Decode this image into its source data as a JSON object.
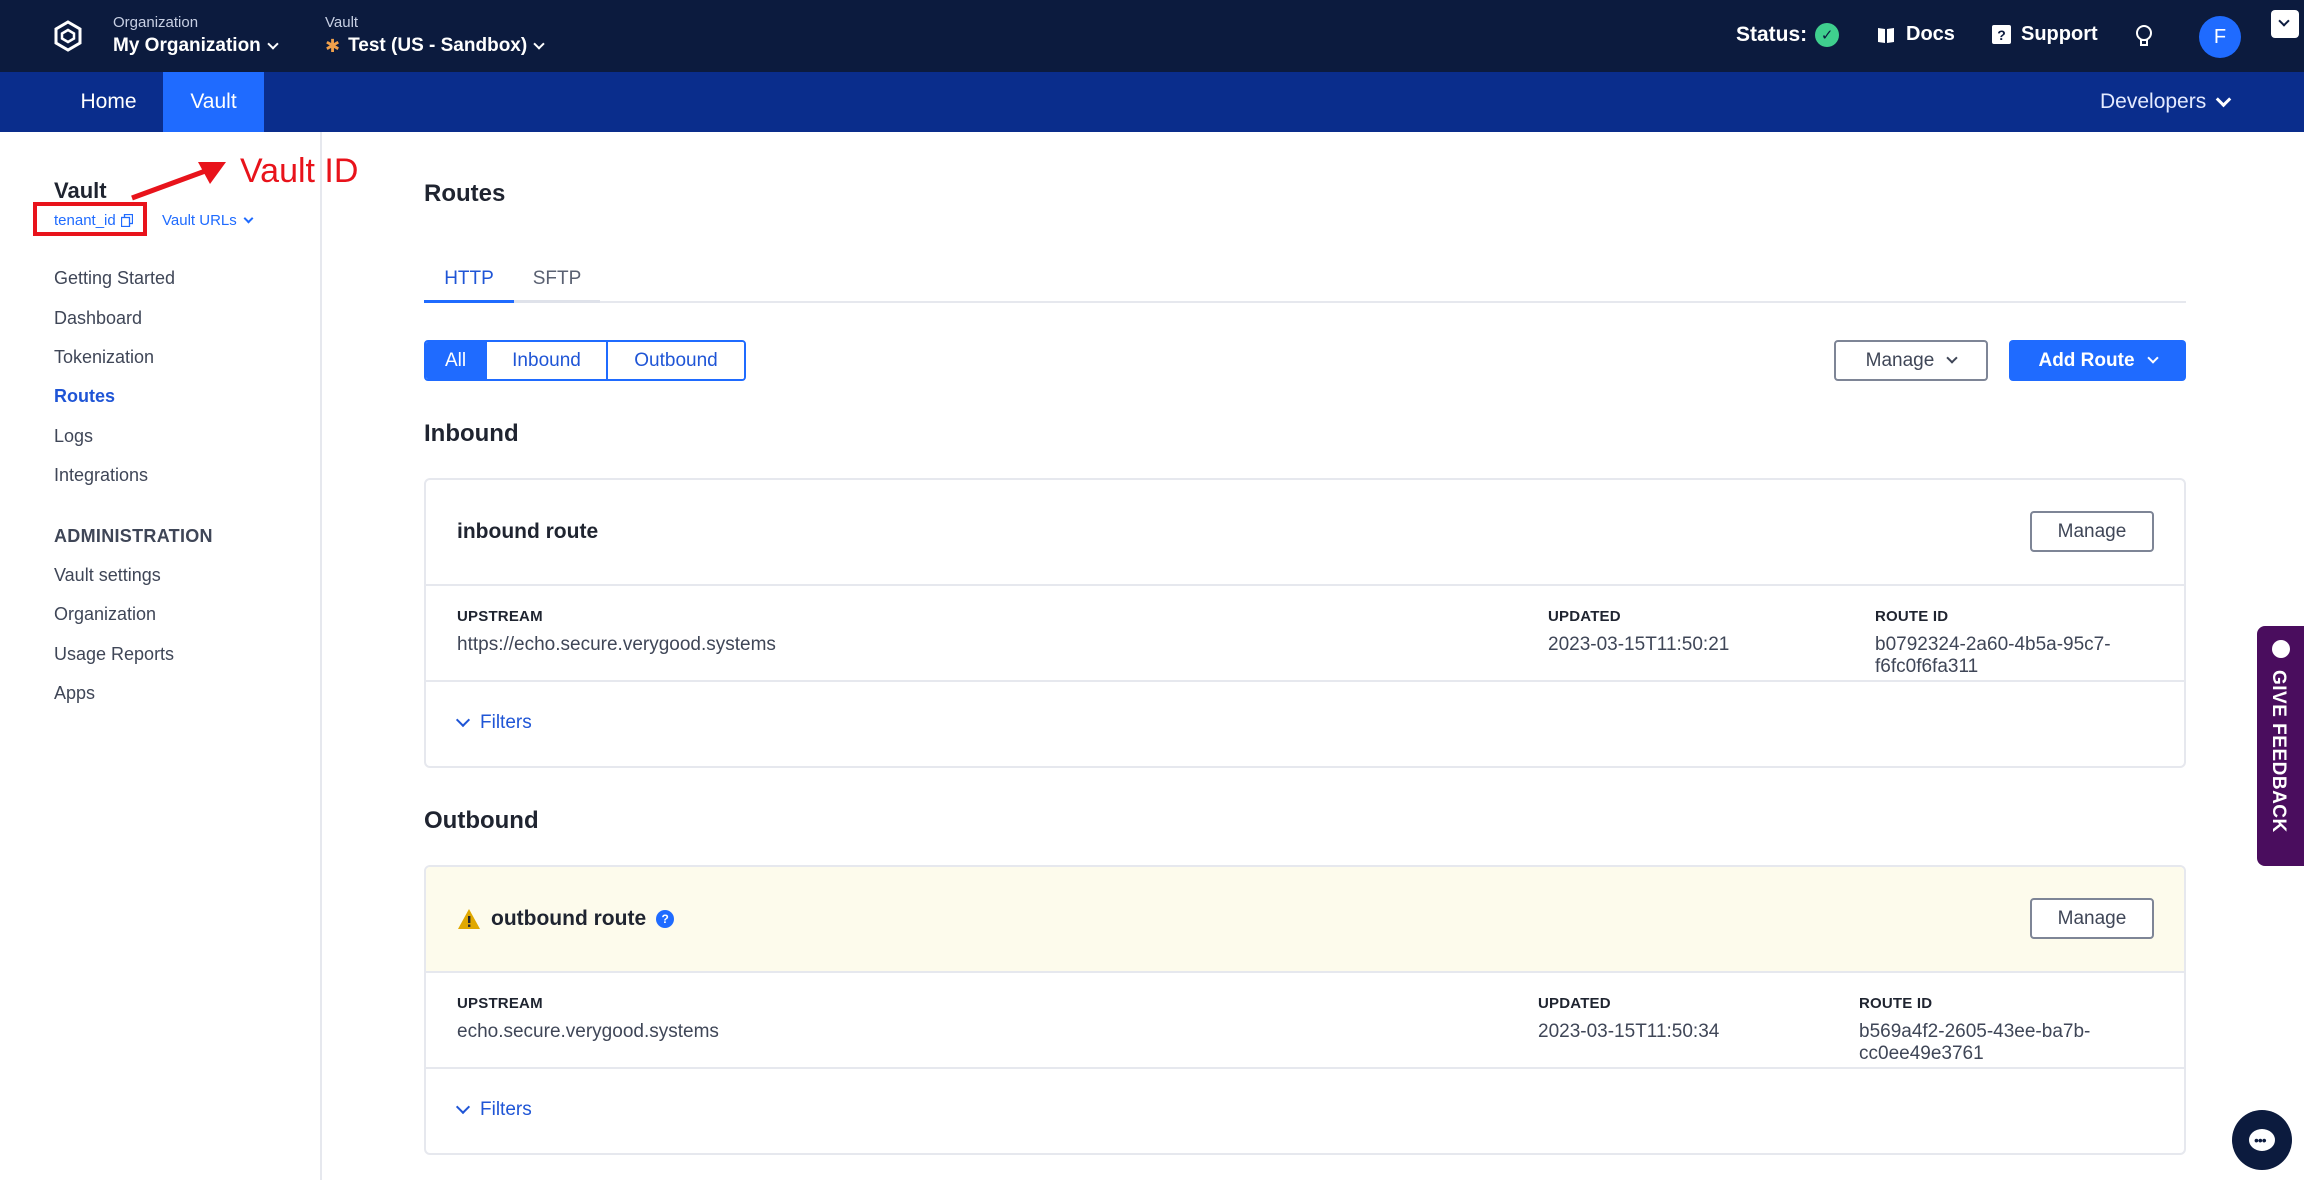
{
  "topbar": {
    "org_label": "Organization",
    "org_value": "My Organization",
    "vault_label": "Vault",
    "vault_value": "Test (US - Sandbox)",
    "status_label": "Status:",
    "docs": "Docs",
    "support": "Support",
    "avatar_initial": "F"
  },
  "nav": {
    "home": "Home",
    "vault": "Vault",
    "developers": "Developers"
  },
  "sidebar": {
    "title": "Vault",
    "tenant": "tenant_id",
    "vault_urls": "Vault URLs",
    "annotation": "Vault ID",
    "items": [
      "Getting Started",
      "Dashboard",
      "Tokenization",
      "Routes",
      "Logs",
      "Integrations"
    ],
    "admin_heading": "ADMINISTRATION",
    "admin_items": [
      "Vault settings",
      "Organization",
      "Usage Reports",
      "Apps"
    ]
  },
  "main": {
    "title": "Routes",
    "tabs": [
      "HTTP",
      "SFTP"
    ],
    "filters": [
      "All",
      "Inbound",
      "Outbound"
    ],
    "manage": "Manage",
    "add_route": "Add Route",
    "inbound_section": "Inbound",
    "outbound_section": "Outbound",
    "col_upstream": "UPSTREAM",
    "col_updated": "UPDATED",
    "col_route_id": "ROUTE ID",
    "filters_link": "Filters",
    "inbound_route": {
      "name": "inbound route",
      "upstream": "https://echo.secure.verygood.systems",
      "updated": "2023-03-15T11:50:21",
      "route_id": "b0792324-2a60-4b5a-95c7-f6fc0f6fa311"
    },
    "outbound_route": {
      "name": "outbound route",
      "upstream": "echo.secure.verygood.systems",
      "updated": "2023-03-15T11:50:34",
      "route_id": "b569a4f2-2605-43ee-ba7b-cc0ee49e3761"
    }
  },
  "feedback": "GIVE FEEDBACK",
  "colors": {
    "topbar": "#0c1b3e",
    "navbar": "#0a2d8c",
    "accent": "#1f6bff",
    "annotation": "#e8131b",
    "warning_bg": "#fdfbec"
  }
}
